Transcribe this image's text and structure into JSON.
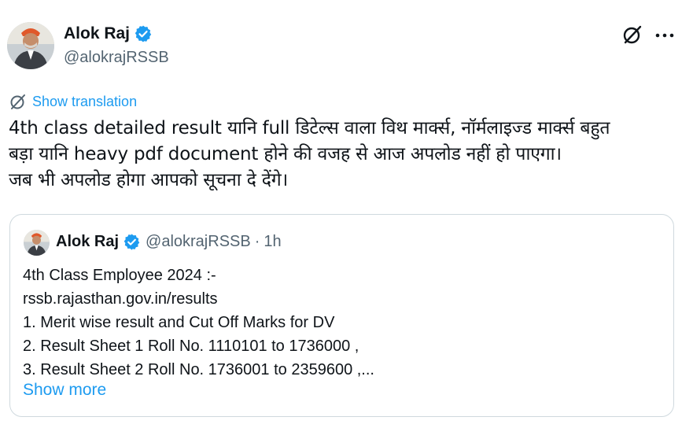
{
  "author": {
    "name": "Alok Raj",
    "handle": "@alokrajRSSB"
  },
  "translation": {
    "label": "Show translation"
  },
  "tweet": {
    "lines": [
      "4th class detailed result यानि full डिटेल्स वाला विथ मार्क्स, नॉर्मलाइज्ड मार्क्स बहुत",
      "बड़ा यानि heavy pdf document होने की वजह से आज अपलोड नहीं हो पाएगा।",
      "जब भी अपलोड होगा आपको सूचना दे देंगे।"
    ]
  },
  "quote": {
    "name": "Alok Raj",
    "handle": "@alokrajRSSB",
    "separator": "·",
    "time": "1h",
    "lines": [
      "4th Class Employee 2024 :-",
      "rssb.rajasthan.gov.in/results",
      "1. Merit wise result and Cut Off Marks for DV",
      "2. Result Sheet 1 Roll No. 1110101 to 1736000 ,",
      "3. Result Sheet 2 Roll No. 1736001 to 2359600 ,..."
    ],
    "show_more": "Show more"
  },
  "icons": {
    "verified": "verified-badge-icon",
    "grok": "grok-icon",
    "more": "more-options-icon",
    "translate": "translate-icon"
  },
  "colors": {
    "accent": "#1d9bf0",
    "text": "#0f1419",
    "muted": "#536471",
    "border": "#cfd9de"
  }
}
